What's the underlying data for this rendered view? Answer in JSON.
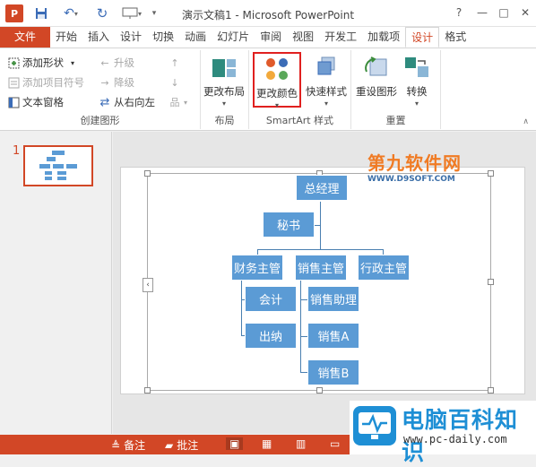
{
  "window": {
    "app_icon": "P",
    "title": "演示文稿1 - Microsoft PowerPoint",
    "help": "?",
    "minimize": "—",
    "maximize": "□",
    "close": "✕"
  },
  "tabs": [
    "文件",
    "开始",
    "插入",
    "设计",
    "切换",
    "动画",
    "幻灯片",
    "审阅",
    "视图",
    "开发工",
    "加载项",
    "设计",
    "格式"
  ],
  "ribbon": {
    "create": {
      "label": "创建图形",
      "add_shape": "添加形状",
      "add_bullet": "添加项目符号",
      "text_pane": "文本窗格",
      "promote": "升级",
      "demote": "降级",
      "rtl": "从右向左"
    },
    "layout": {
      "label": "布局",
      "change_layout": "更改布局"
    },
    "smartart_styles": {
      "label": "SmartArt 样式",
      "change_colors": "更改颜色",
      "quick_styles": "快速样式"
    },
    "reset": {
      "label": "重置",
      "reset_graphic": "重设图形",
      "convert": "转换"
    }
  },
  "slides": {
    "number": "1"
  },
  "org_chart": {
    "top": "总经理",
    "assistant": "秘书",
    "level2": [
      "财务主管",
      "销售主管",
      "行政主管"
    ],
    "finance_children": [
      "会计",
      "出纳"
    ],
    "sales_children": [
      "销售助理",
      "销售A",
      "销售B"
    ]
  },
  "watermarks": {
    "top_title": "第九软件网",
    "top_url": "WWW.D9SOFT.COM",
    "bottom_title": "电脑百科知识",
    "bottom_url": "www.pc-daily.com"
  },
  "statusbar": {
    "notes": "备注",
    "comments": "批注"
  },
  "colors": {
    "accent": "#d24726",
    "node": "#5b9bd5",
    "highlight": "#e0201f"
  }
}
